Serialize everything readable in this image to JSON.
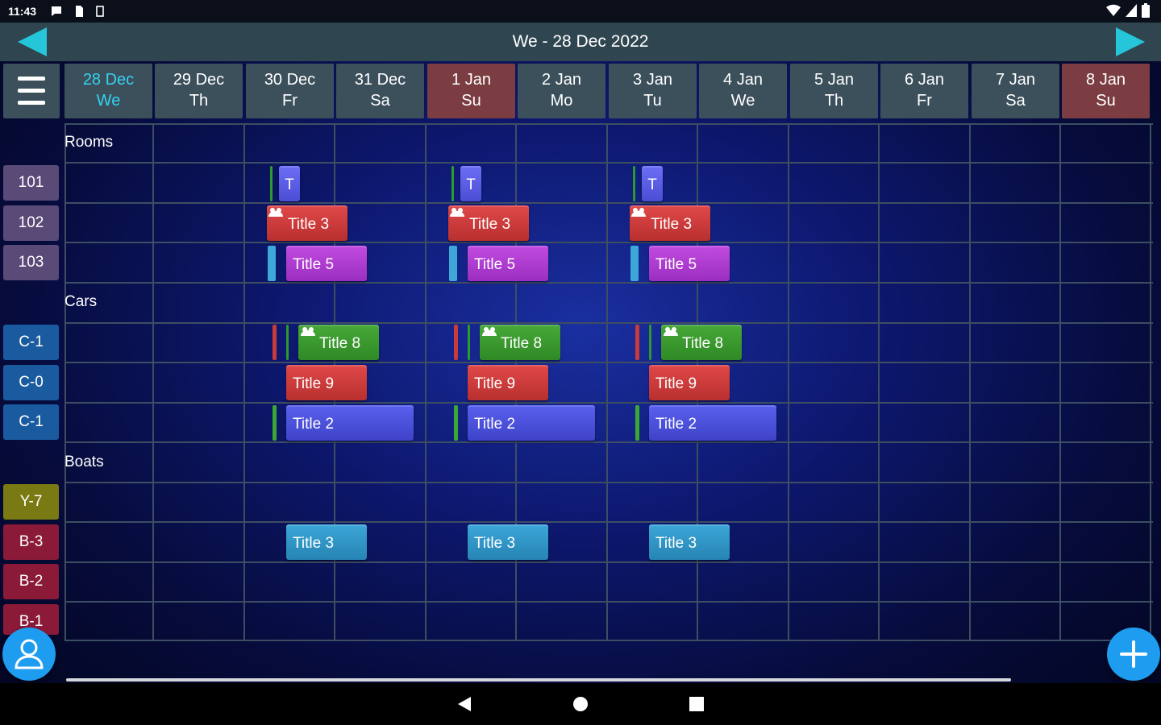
{
  "status": {
    "time": "11:43"
  },
  "header": {
    "title": "We - 28 Dec 2022"
  },
  "days": [
    {
      "date": "28 Dec",
      "weekday": "We"
    },
    {
      "date": "29 Dec",
      "weekday": "Th"
    },
    {
      "date": "30 Dec",
      "weekday": "Fr"
    },
    {
      "date": "31 Dec",
      "weekday": "Sa"
    },
    {
      "date": "1 Jan",
      "weekday": "Su"
    },
    {
      "date": "2 Jan",
      "weekday": "Mo"
    },
    {
      "date": "3 Jan",
      "weekday": "Tu"
    },
    {
      "date": "4 Jan",
      "weekday": "We"
    },
    {
      "date": "5 Jan",
      "weekday": "Th"
    },
    {
      "date": "6 Jan",
      "weekday": "Fr"
    },
    {
      "date": "7 Jan",
      "weekday": "Sa"
    },
    {
      "date": "8 Jan",
      "weekday": "Su"
    }
  ],
  "groups": {
    "rooms": "Rooms",
    "cars": "Cars",
    "boats": "Boats"
  },
  "resources": {
    "r101": "101",
    "r102": "102",
    "r103": "103",
    "c1a": "C-1",
    "c0": "C-0",
    "c1b": "C-1",
    "y7": "Y-7",
    "b3": "B-3",
    "b2": "B-2",
    "b1": "B-1"
  },
  "events": {
    "t": "T",
    "title3": "Title 3",
    "title5": "Title 5",
    "title8": "Title 8",
    "title9": "Title 9",
    "title2": "Title 2"
  },
  "colors": {
    "today": "#35d1f0",
    "weekend": "#7b3d42",
    "header": "#3c505c",
    "accent": "#1e9cf0"
  },
  "icons": [
    "back-arrow-icon",
    "forward-arrow-icon",
    "menu-icon",
    "user-icon",
    "plus-icon"
  ]
}
